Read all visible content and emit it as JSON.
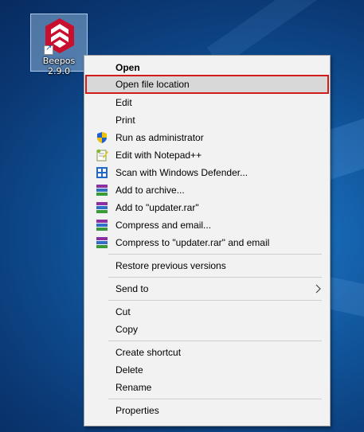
{
  "desktop": {
    "icon_label": "Beepos 2.9.0",
    "icon_name": "beepos-logo-icon"
  },
  "menu": {
    "items": [
      {
        "label": "Open",
        "icon": null
      },
      {
        "label": "Open file location",
        "icon": null
      },
      {
        "label": "Edit",
        "icon": null
      },
      {
        "label": "Print",
        "icon": null
      },
      {
        "label": "Run as administrator",
        "icon": "uac-shield-icon"
      },
      {
        "label": "Edit with Notepad++",
        "icon": "notepadpp-icon"
      },
      {
        "label": "Scan with Windows Defender...",
        "icon": "defender-icon"
      },
      {
        "label": "Add to archive...",
        "icon": "winrar-icon"
      },
      {
        "label": "Add to \"updater.rar\"",
        "icon": "winrar-icon"
      },
      {
        "label": "Compress and email...",
        "icon": "winrar-icon"
      },
      {
        "label": "Compress to \"updater.rar\" and email",
        "icon": "winrar-icon"
      },
      {
        "label": "Restore previous versions",
        "icon": null
      },
      {
        "label": "Send to",
        "icon": "chevron-right-icon"
      },
      {
        "label": "Cut",
        "icon": null
      },
      {
        "label": "Copy",
        "icon": null
      },
      {
        "label": "Create shortcut",
        "icon": null
      },
      {
        "label": "Delete",
        "icon": null
      },
      {
        "label": "Rename",
        "icon": null
      },
      {
        "label": "Properties",
        "icon": null
      }
    ],
    "highlighted_color": "#d01c1c"
  }
}
